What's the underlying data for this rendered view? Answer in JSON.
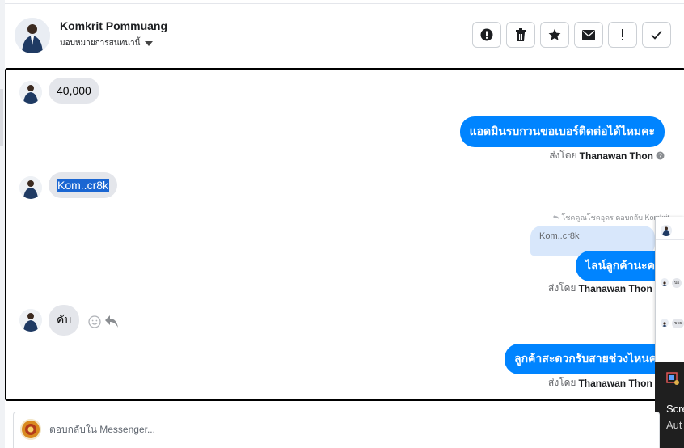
{
  "header": {
    "contact_name": "Komkrit Pommuang",
    "assign_label": "มอบหมายการสนทนานี้",
    "actions": [
      {
        "icon": "alert-circle-icon"
      },
      {
        "icon": "trash-icon"
      },
      {
        "icon": "star-icon"
      },
      {
        "icon": "envelope-icon"
      },
      {
        "icon": "exclamation-icon"
      },
      {
        "icon": "checkmark-icon"
      }
    ]
  },
  "messages": {
    "m1": "40,000",
    "m2": "แอดมินรบกวนขอเบอร์ติดต่อได้ไหมคะ",
    "m2_sent_prefix": "ส่งโดย",
    "m2_sender": "Thanawan Thon",
    "m3": "Kom..cr8k",
    "m4_reply_hint": "โชคคูณโชคอุดร ตอบกลับ Komkrit",
    "m4_quote": "Kom..cr8k",
    "m4": "ไลน์ลูกค้านะคะ",
    "m4_sent_prefix": "ส่งโดย",
    "m4_sender": "Thanawan Thon",
    "m5": "คับ",
    "m6": "ลูกค้าสะดวกรับสายช่วงไหนคะ",
    "m6_sent_prefix": "ส่งโดย",
    "m6_sender": "Thanawan Thon"
  },
  "overlay": {
    "bubble1": "ปอ",
    "bubble2": "ขาย",
    "footer_line1": "Scre",
    "footer_line2": "Aut"
  },
  "composer": {
    "placeholder": "ตอบกลับใน Messenger..."
  },
  "colors": {
    "accent": "#0084ff",
    "incoming_bubble": "#e4e6eb",
    "quote_bubble": "#d8e7fb",
    "selection": "#1a66d2"
  }
}
